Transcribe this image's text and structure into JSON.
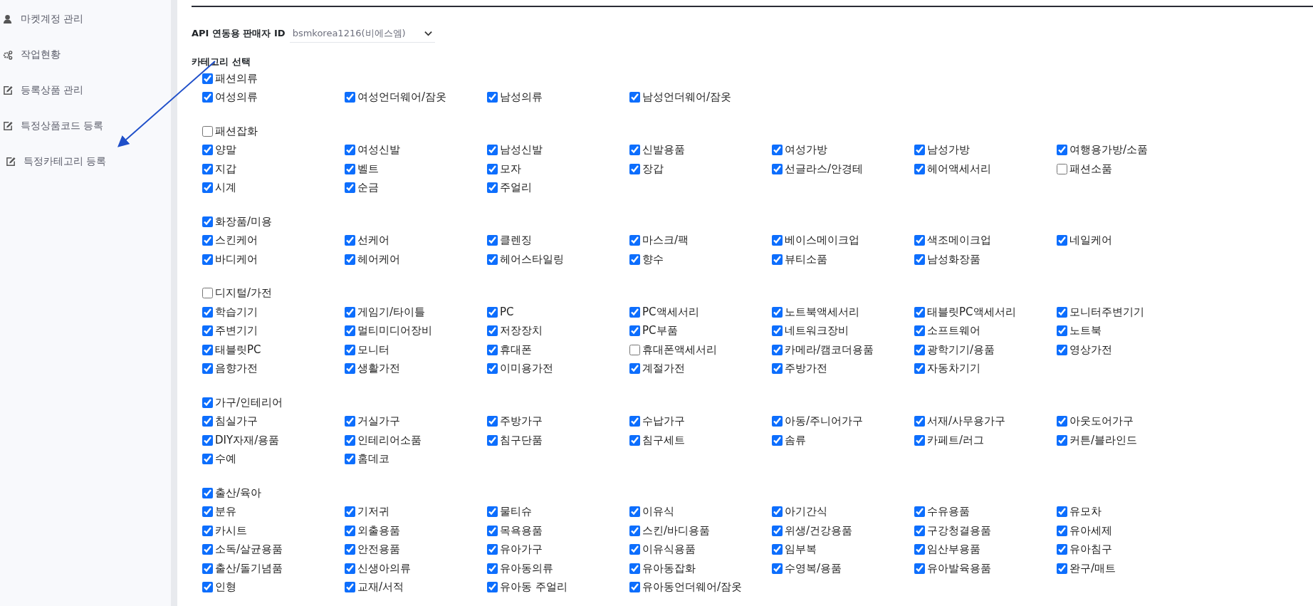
{
  "sidebar": {
    "items": [
      {
        "label": "마켓계정 관리",
        "kind": "account"
      },
      {
        "label": "작업현황",
        "kind": "status"
      },
      {
        "label": "등록상품 관리",
        "kind": "edit"
      },
      {
        "label": "특정상품코드 등록",
        "kind": "edit"
      },
      {
        "label": "특정카테고리 등록",
        "kind": "edit"
      }
    ]
  },
  "seller_field": {
    "label": "API 연동용 판매자 ID",
    "value": "bsmkorea1216(비에스엠)"
  },
  "category_section": {
    "title": "카테고리 선택",
    "groups": [
      {
        "label": "패션의류",
        "checked": true,
        "children": [
          {
            "label": "여성의류",
            "checked": true
          },
          {
            "label": "여성언더웨어/잠옷",
            "checked": true
          },
          {
            "label": "남성의류",
            "checked": true
          },
          {
            "label": "남성언더웨어/잠옷",
            "checked": true
          }
        ]
      },
      {
        "label": "패션잡화",
        "checked": false,
        "children": [
          {
            "label": "양말",
            "checked": true
          },
          {
            "label": "여성신발",
            "checked": true
          },
          {
            "label": "남성신발",
            "checked": true
          },
          {
            "label": "신발용품",
            "checked": true
          },
          {
            "label": "여성가방",
            "checked": true
          },
          {
            "label": "남성가방",
            "checked": true
          },
          {
            "label": "여행용가방/소품",
            "checked": true
          },
          {
            "label": "지갑",
            "checked": true
          },
          {
            "label": "벨트",
            "checked": true
          },
          {
            "label": "모자",
            "checked": true
          },
          {
            "label": "장갑",
            "checked": true
          },
          {
            "label": "선글라스/안경테",
            "checked": true
          },
          {
            "label": "헤어액세서리",
            "checked": true
          },
          {
            "label": "패션소품",
            "checked": false
          },
          {
            "label": "시계",
            "checked": true
          },
          {
            "label": "순금",
            "checked": true
          },
          {
            "label": "주얼리",
            "checked": true
          }
        ]
      },
      {
        "label": "화장품/미용",
        "checked": true,
        "children": [
          {
            "label": "스킨케어",
            "checked": true
          },
          {
            "label": "선케어",
            "checked": true
          },
          {
            "label": "클렌징",
            "checked": true
          },
          {
            "label": "마스크/팩",
            "checked": true
          },
          {
            "label": "베이스메이크업",
            "checked": true
          },
          {
            "label": "색조메이크업",
            "checked": true
          },
          {
            "label": "네일케어",
            "checked": true
          },
          {
            "label": "바디케어",
            "checked": true
          },
          {
            "label": "헤어케어",
            "checked": true
          },
          {
            "label": "헤어스타일링",
            "checked": true
          },
          {
            "label": "향수",
            "checked": true
          },
          {
            "label": "뷰티소품",
            "checked": true
          },
          {
            "label": "남성화장품",
            "checked": true
          }
        ]
      },
      {
        "label": "디지털/가전",
        "checked": false,
        "children": [
          {
            "label": "학습기기",
            "checked": true
          },
          {
            "label": "게임기/타이틀",
            "checked": true
          },
          {
            "label": "PC",
            "checked": true
          },
          {
            "label": "PC액세서리",
            "checked": true
          },
          {
            "label": "노트북액세서리",
            "checked": true
          },
          {
            "label": "태블릿PC액세서리",
            "checked": true
          },
          {
            "label": "모니터주변기기",
            "checked": true
          },
          {
            "label": "주변기기",
            "checked": true
          },
          {
            "label": "멀티미디어장비",
            "checked": true
          },
          {
            "label": "저장장치",
            "checked": true
          },
          {
            "label": "PC부품",
            "checked": true
          },
          {
            "label": "네트워크장비",
            "checked": true
          },
          {
            "label": "소프트웨어",
            "checked": true
          },
          {
            "label": "노트북",
            "checked": true
          },
          {
            "label": "태블릿PC",
            "checked": true
          },
          {
            "label": "모니터",
            "checked": true
          },
          {
            "label": "휴대폰",
            "checked": true
          },
          {
            "label": "휴대폰액세서리",
            "checked": false
          },
          {
            "label": "카메라/캠코더용품",
            "checked": true
          },
          {
            "label": "광학기기/용품",
            "checked": true
          },
          {
            "label": "영상가전",
            "checked": true
          },
          {
            "label": "음향가전",
            "checked": true
          },
          {
            "label": "생활가전",
            "checked": true
          },
          {
            "label": "이미용가전",
            "checked": true
          },
          {
            "label": "계절가전",
            "checked": true
          },
          {
            "label": "주방가전",
            "checked": true
          },
          {
            "label": "자동차기기",
            "checked": true
          }
        ]
      },
      {
        "label": "가구/인테리어",
        "checked": true,
        "children": [
          {
            "label": "침실가구",
            "checked": true
          },
          {
            "label": "거실가구",
            "checked": true
          },
          {
            "label": "주방가구",
            "checked": true
          },
          {
            "label": "수납가구",
            "checked": true
          },
          {
            "label": "아동/주니어가구",
            "checked": true
          },
          {
            "label": "서재/사무용가구",
            "checked": true
          },
          {
            "label": "아웃도어가구",
            "checked": true
          },
          {
            "label": "DIY자재/용품",
            "checked": true
          },
          {
            "label": "인테리어소품",
            "checked": true
          },
          {
            "label": "침구단품",
            "checked": true
          },
          {
            "label": "침구세트",
            "checked": true
          },
          {
            "label": "솜류",
            "checked": true
          },
          {
            "label": "카페트/러그",
            "checked": true
          },
          {
            "label": "커튼/블라인드",
            "checked": true
          },
          {
            "label": "수예",
            "checked": true
          },
          {
            "label": "홈데코",
            "checked": true
          }
        ]
      },
      {
        "label": "출산/육아",
        "checked": true,
        "children": [
          {
            "label": "분유",
            "checked": true
          },
          {
            "label": "기저귀",
            "checked": true
          },
          {
            "label": "물티슈",
            "checked": true
          },
          {
            "label": "이유식",
            "checked": true
          },
          {
            "label": "아기간식",
            "checked": true
          },
          {
            "label": "수유용품",
            "checked": true
          },
          {
            "label": "유모차",
            "checked": true
          },
          {
            "label": "카시트",
            "checked": true
          },
          {
            "label": "외출용품",
            "checked": true
          },
          {
            "label": "목욕용품",
            "checked": true
          },
          {
            "label": "스킨/바디용품",
            "checked": true
          },
          {
            "label": "위생/건강용품",
            "checked": true
          },
          {
            "label": "구강청결용품",
            "checked": true
          },
          {
            "label": "유아세제",
            "checked": true
          },
          {
            "label": "소독/살균용품",
            "checked": true
          },
          {
            "label": "안전용품",
            "checked": true
          },
          {
            "label": "유아가구",
            "checked": true
          },
          {
            "label": "이유식용품",
            "checked": true
          },
          {
            "label": "임부복",
            "checked": true
          },
          {
            "label": "임산부용품",
            "checked": true
          },
          {
            "label": "유아침구",
            "checked": true
          },
          {
            "label": "출산/돌기념품",
            "checked": true
          },
          {
            "label": "신생아의류",
            "checked": true
          },
          {
            "label": "유아동의류",
            "checked": true
          },
          {
            "label": "유아동잡화",
            "checked": true
          },
          {
            "label": "수영복/용품",
            "checked": true
          },
          {
            "label": "유아발육용품",
            "checked": true
          },
          {
            "label": "완구/매트",
            "checked": true
          },
          {
            "label": "인형",
            "checked": true
          },
          {
            "label": "교재/서적",
            "checked": true
          },
          {
            "label": "유아동 주얼리",
            "checked": true
          },
          {
            "label": "유아동언더웨어/잠옷",
            "checked": true
          }
        ]
      }
    ]
  }
}
